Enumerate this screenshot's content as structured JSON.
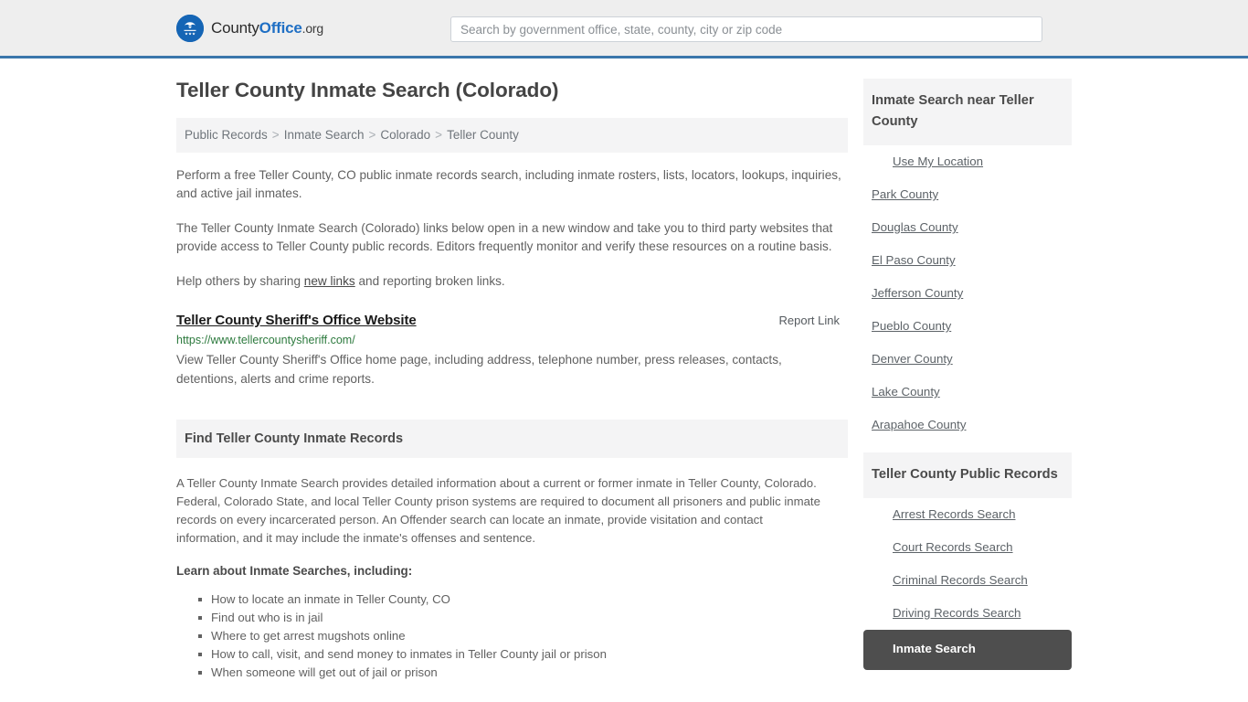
{
  "header": {
    "brand": {
      "part1": "County",
      "part2": "Office",
      "part3": ".org",
      "logo_icon": "eagle-seal-icon"
    },
    "search": {
      "placeholder": "Search by government office, state, county, city or zip code",
      "value": ""
    }
  },
  "page": {
    "title": "Teller County Inmate Search (Colorado)"
  },
  "breadcrumb": {
    "items": [
      {
        "label": "Public Records"
      },
      {
        "label": "Inmate Search"
      },
      {
        "label": "Colorado"
      },
      {
        "label": "Teller County"
      }
    ],
    "separator": ">"
  },
  "intro": {
    "paragraph1": "Perform a free Teller County, CO public inmate records search, including inmate rosters, lists, locators, lookups, inquiries, and active jail inmates.",
    "paragraph2": "The Teller County Inmate Search (Colorado) links below open in a new window and take you to third party websites that provide access to Teller County public records. Editors frequently monitor and verify these resources on a routine basis.",
    "help_prefix": "Help others by sharing ",
    "help_link": "new links",
    "help_suffix": " and reporting broken links."
  },
  "result": {
    "title": "Teller County Sheriff's Office Website",
    "report_label": "Report Link",
    "url": "https://www.tellercountysheriff.com/",
    "description": "View Teller County Sheriff's Office home page, including address, telephone number, press releases, contacts, detentions, alerts and crime reports."
  },
  "find_section": {
    "heading": "Find Teller County Inmate Records",
    "paragraph": "A Teller County Inmate Search provides detailed information about a current or former inmate in Teller County, Colorado. Federal, Colorado State, and local Teller County prison systems are required to document all prisoners and public inmate records on every incarcerated person. An Offender search can locate an inmate, provide visitation and contact information, and it may include the inmate's offenses and sentence.",
    "learn_heading": "Learn about Inmate Searches, including:",
    "topics": [
      "How to locate an inmate in Teller County, CO",
      "Find out who is in jail",
      "Where to get arrest mugshots online",
      "How to call, visit, and send money to inmates in Teller County jail or prison",
      "When someone will get out of jail or prison"
    ]
  },
  "sidebar": {
    "nearby": {
      "heading": "Inmate Search near Teller County",
      "items": [
        {
          "label": "Use My Location",
          "indented": true,
          "active": false
        },
        {
          "label": "Park County",
          "indented": false,
          "active": false
        },
        {
          "label": "Douglas County",
          "indented": false,
          "active": false
        },
        {
          "label": "El Paso County",
          "indented": false,
          "active": false
        },
        {
          "label": "Jefferson County",
          "indented": false,
          "active": false
        },
        {
          "label": "Pueblo County",
          "indented": false,
          "active": false
        },
        {
          "label": "Denver County",
          "indented": false,
          "active": false
        },
        {
          "label": "Lake County",
          "indented": false,
          "active": false
        },
        {
          "label": "Arapahoe County",
          "indented": false,
          "active": false
        }
      ]
    },
    "public_records": {
      "heading": "Teller County Public Records",
      "items": [
        {
          "label": "Arrest Records Search",
          "indented": true,
          "active": false
        },
        {
          "label": "Court Records Search",
          "indented": true,
          "active": false
        },
        {
          "label": "Criminal Records Search",
          "indented": true,
          "active": false
        },
        {
          "label": "Driving Records Search",
          "indented": true,
          "active": false
        },
        {
          "label": "Inmate Search",
          "indented": true,
          "active": true
        }
      ]
    }
  },
  "colors": {
    "header_bg": "#eeeeee",
    "header_rule": "#3a76ab",
    "panel_bg": "#f4f4f5",
    "brand_blue": "#1f6fc4",
    "link_green": "#2d7a3e",
    "active_bg": "#4e4e4e",
    "text": "#616161"
  }
}
